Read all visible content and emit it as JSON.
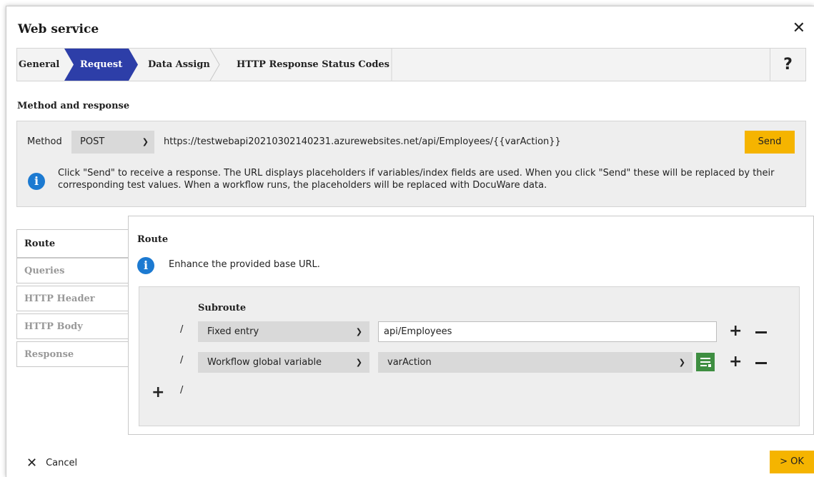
{
  "dialog": {
    "title": "Web service",
    "close_icon": "close-icon",
    "help_icon": "help-icon"
  },
  "wizard": {
    "steps": [
      {
        "label": "General"
      },
      {
        "label": "Request",
        "active": true
      },
      {
        "label": "Data Assign"
      },
      {
        "label": "HTTP Response Status Codes"
      }
    ],
    "help_label": "?"
  },
  "method_section": {
    "title": "Method and response",
    "method_label": "Method",
    "method_value": "POST",
    "url": "https://testwebapi20210302140231.azurewebsites.net/api/Employees/{{varAction}}",
    "send_label": "Send",
    "info_text": "Click \"Send\" to receive a response. The URL displays placeholders if variables/index fields are used. When you click \"Send\" these will be replaced by their corresponding test values. When a workflow runs, the placeholders will be replaced with DocuWare data."
  },
  "side_tabs": [
    {
      "label": "Route",
      "active": true
    },
    {
      "label": "Queries"
    },
    {
      "label": "HTTP Header"
    },
    {
      "label": "HTTP Body"
    },
    {
      "label": "Response"
    }
  ],
  "route": {
    "title": "Route",
    "hint": "Enhance the provided base URL.",
    "subroute_title": "Subroute",
    "rows": [
      {
        "slash": "/",
        "type": "Fixed entry",
        "value": "api/Employees"
      },
      {
        "slash": "/",
        "type": "Workflow global variable",
        "value": "varAction"
      }
    ],
    "add_slash": "/"
  },
  "footer": {
    "cancel_label": "Cancel",
    "ok_label": "> OK"
  },
  "colors": {
    "active_step": "#2d3ea8",
    "accent_button": "#f5b400",
    "info_icon": "#1c7ad1",
    "variable_button": "#3e8e41"
  }
}
